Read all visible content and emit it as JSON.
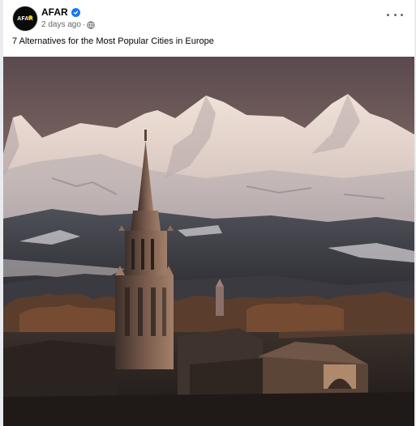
{
  "post": {
    "author": {
      "name": "AFAR",
      "avatar_text": "AFAR",
      "verified": true
    },
    "timestamp": "2 days ago",
    "separator": "·",
    "audience_icon": "globe-icon",
    "more_icon": "more-options-icon",
    "caption": "7 Alternatives for the Most Popular Cities in Europe",
    "image": {
      "subject": "photo",
      "colors": {
        "sky_top": "#5a4a4e",
        "sky_glow": "#c09a86",
        "snow": "#e9d9cf",
        "shadow": "#2a2624"
      }
    }
  }
}
